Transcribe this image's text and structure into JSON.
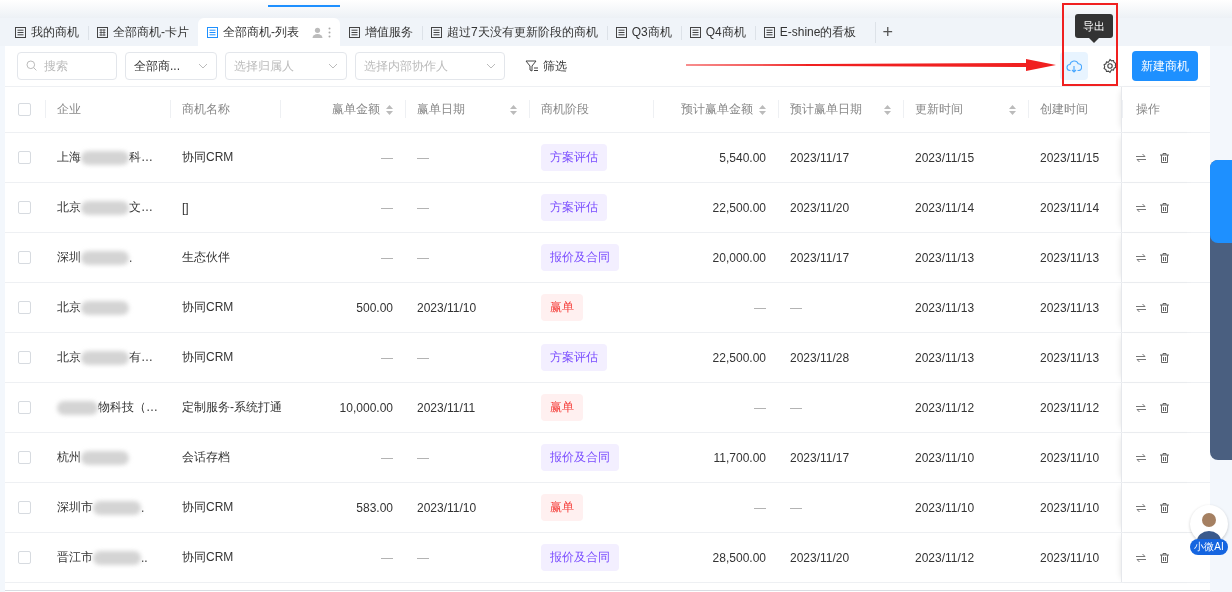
{
  "tabs": [
    {
      "label": "我的商机",
      "kind": "list",
      "selected": false
    },
    {
      "label": "全部商机-卡片",
      "kind": "card",
      "selected": false
    },
    {
      "label": "全部商机-列表",
      "kind": "list",
      "selected": true
    },
    {
      "label": "增值服务",
      "kind": "list",
      "selected": false
    },
    {
      "label": "超过7天没有更新阶段的商机",
      "kind": "list",
      "selected": false
    },
    {
      "label": "Q3商机",
      "kind": "list",
      "selected": false
    },
    {
      "label": "Q4商机",
      "kind": "list",
      "selected": false
    },
    {
      "label": "E-shine的看板",
      "kind": "list",
      "selected": false
    }
  ],
  "add_tab": "+",
  "toolbar": {
    "search": {
      "placeholder": "搜索"
    },
    "scope": {
      "value": "全部商..."
    },
    "owner": {
      "placeholder": "选择归属人"
    },
    "collaborator": {
      "placeholder": "选择内部协作人"
    },
    "filter": "筛选",
    "export_tooltip": "导出",
    "new_button": "新建商机"
  },
  "table": {
    "all_checked": false,
    "columns": [
      {
        "label": "企业",
        "sortable": false,
        "kind": "text"
      },
      {
        "label": "商机名称",
        "sortable": false,
        "kind": "text"
      },
      {
        "label": "赢单金额",
        "sortable": true,
        "kind": "number"
      },
      {
        "label": "赢单日期",
        "sortable": true,
        "kind": "text"
      },
      {
        "label": "商机阶段",
        "sortable": false,
        "kind": "text"
      },
      {
        "label": "预计赢单金额",
        "sortable": true,
        "kind": "number"
      },
      {
        "label": "预计赢单日期",
        "sortable": true,
        "kind": "text"
      },
      {
        "label": "更新时间",
        "sortable": true,
        "kind": "text"
      },
      {
        "label": "创建时间",
        "sortable": false,
        "kind": "text"
      },
      {
        "label": "操作",
        "sortable": false,
        "kind": "text"
      }
    ],
    "rows": [
      {
        "checked": false,
        "company_prefix": "上海",
        "company_suffix": "科…",
        "name": "协同CRM",
        "amount": "—",
        "date": "—",
        "stage": {
          "label": "方案评估",
          "kind": "progress"
        },
        "expected_amount": "5,540.00",
        "expected_date": "2023/11/17",
        "updated": "2023/11/15",
        "created": "2023/11/15"
      },
      {
        "checked": false,
        "company_prefix": "北京",
        "company_suffix": "文…",
        "name": "[]",
        "amount": "—",
        "date": "—",
        "stage": {
          "label": "方案评估",
          "kind": "progress"
        },
        "expected_amount": "22,500.00",
        "expected_date": "2023/11/20",
        "updated": "2023/11/14",
        "created": "2023/11/14"
      },
      {
        "checked": false,
        "company_prefix": "深圳",
        "company_suffix": ".",
        "name": "生态伙伴",
        "amount": "—",
        "date": "—",
        "stage": {
          "label": "报价及合同",
          "kind": "progress"
        },
        "expected_amount": "20,000.00",
        "expected_date": "2023/11/17",
        "updated": "2023/11/13",
        "created": "2023/11/13"
      },
      {
        "checked": false,
        "company_prefix": "北京",
        "company_suffix": "",
        "name": "协同CRM",
        "amount": "500.00",
        "date": "2023/11/10",
        "stage": {
          "label": "赢单",
          "kind": "won"
        },
        "expected_amount": "—",
        "expected_date": "—",
        "updated": "2023/11/13",
        "created": "2023/11/13"
      },
      {
        "checked": false,
        "company_prefix": "北京",
        "company_suffix": "有…",
        "name": "协同CRM",
        "amount": "—",
        "date": "—",
        "stage": {
          "label": "方案评估",
          "kind": "progress"
        },
        "expected_amount": "22,500.00",
        "expected_date": "2023/11/28",
        "updated": "2023/11/13",
        "created": "2023/11/13"
      },
      {
        "checked": false,
        "company_prefix": "",
        "company_suffix": "物科技（…",
        "name": "定制服务-系统打通",
        "amount": "10,000.00",
        "date": "2023/11/11",
        "stage": {
          "label": "赢单",
          "kind": "won"
        },
        "expected_amount": "—",
        "expected_date": "—",
        "updated": "2023/11/12",
        "created": "2023/11/12"
      },
      {
        "checked": false,
        "company_prefix": "杭州",
        "company_suffix": "",
        "name": "会话存档",
        "amount": "—",
        "date": "—",
        "stage": {
          "label": "报价及合同",
          "kind": "progress"
        },
        "expected_amount": "11,700.00",
        "expected_date": "2023/11/17",
        "updated": "2023/11/10",
        "created": "2023/11/10"
      },
      {
        "checked": false,
        "company_prefix": "深圳市",
        "company_suffix": ".",
        "name": "协同CRM",
        "amount": "583.00",
        "date": "2023/11/10",
        "stage": {
          "label": "赢单",
          "kind": "won"
        },
        "expected_amount": "—",
        "expected_date": "—",
        "updated": "2023/11/10",
        "created": "2023/11/10"
      },
      {
        "checked": false,
        "company_prefix": "晋江市",
        "company_suffix": "..",
        "name": "协同CRM",
        "amount": "—",
        "date": "—",
        "stage": {
          "label": "报价及合同",
          "kind": "progress"
        },
        "expected_amount": "28,500.00",
        "expected_date": "2023/11/20",
        "updated": "2023/11/12",
        "created": "2023/11/10"
      }
    ]
  },
  "assistant": {
    "label": "小微AI"
  }
}
